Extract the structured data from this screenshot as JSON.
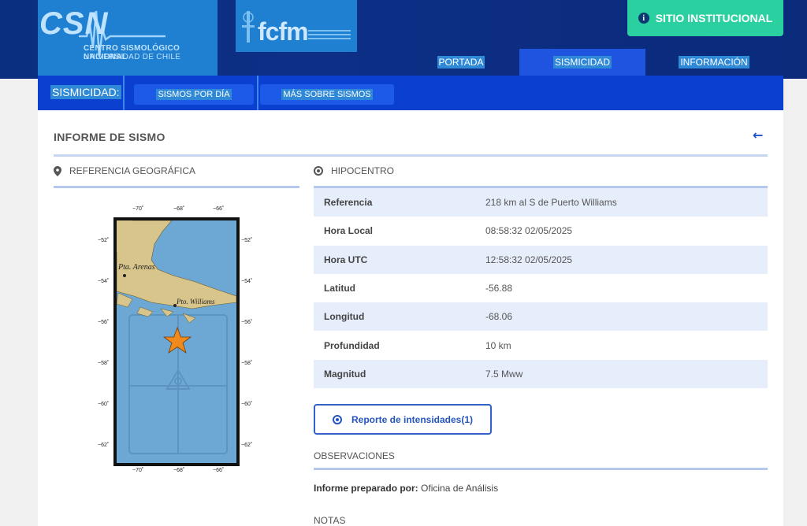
{
  "header": {
    "csn_logo": {
      "wordmark": "CSN",
      "line1": "CENTRO SISMOLÓGICO NACIONAL",
      "line2": "UNIVERSIDAD DE CHILE"
    },
    "fcfm_logo": {
      "wordmark": "fcfm"
    },
    "institutional_button": "SITIO INSTITUCIONAL",
    "nav": [
      {
        "label": "PORTADA",
        "active": false
      },
      {
        "label": "SISMICIDAD",
        "active": true
      },
      {
        "label": "INFORMACIÓN",
        "active": false
      }
    ]
  },
  "subnav": {
    "label": "SISMICIDAD:",
    "buttons": [
      "SISMOS POR DÍA",
      "MÁS SOBRE SISMOS"
    ]
  },
  "page": {
    "title": "INFORME DE SISMO",
    "geo_section": "REFERENCIA GEOGRÁFICA",
    "hypo_section": "HIPOCENTRO"
  },
  "map": {
    "x_ticks": [
      "−70˚",
      "−68˚",
      "−66˚"
    ],
    "y_ticks": [
      "−52˚",
      "−54˚",
      "−56˚",
      "−58˚",
      "−60˚",
      "−62˚"
    ],
    "places": [
      "Pta. Arenas",
      "Pto. Williams"
    ],
    "colors": {
      "ocean": "#6da8d4",
      "land": "#d8c58c",
      "epicenter": "#f08a1c"
    }
  },
  "hypocenter": [
    {
      "key": "Referencia",
      "value": "218 km al S de Puerto Williams"
    },
    {
      "key": "Hora Local",
      "value": "08:58:32 02/05/2025"
    },
    {
      "key": "Hora UTC",
      "value": "12:58:32 02/05/2025"
    },
    {
      "key": "Latitud",
      "value": "-56.88"
    },
    {
      "key": "Longitud",
      "value": "-68.06"
    },
    {
      "key": "Profundidad",
      "value": "10 km"
    },
    {
      "key": "Magnitud",
      "value": "7.5 Mww"
    }
  ],
  "report_button": "Reporte de intensidades(1)",
  "observations": {
    "label": "OBSERVACIONES",
    "prepared_by_label": "Informe preparado por:",
    "prepared_by_value": "Oficina de Análisis"
  },
  "notes_label": "NOTAS"
}
